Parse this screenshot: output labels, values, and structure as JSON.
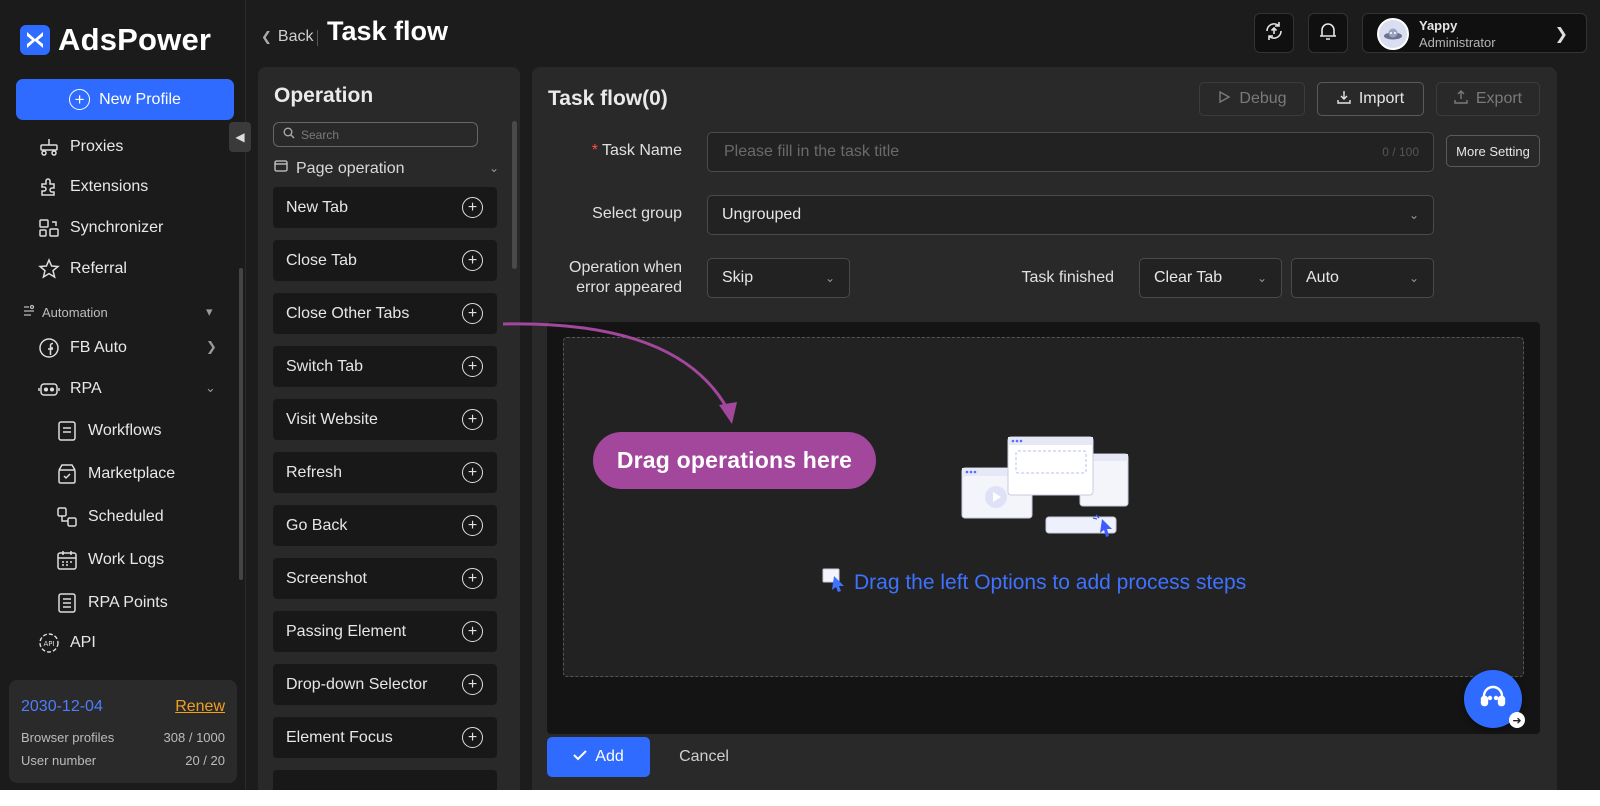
{
  "app": {
    "name": "AdsPower"
  },
  "sidebar": {
    "new_profile_label": "New Profile",
    "items": [
      {
        "label": "Proxies",
        "icon": "proxies-icon"
      },
      {
        "label": "Extensions",
        "icon": "extensions-icon"
      },
      {
        "label": "Synchronizer",
        "icon": "synchronizer-icon"
      },
      {
        "label": "Referral",
        "icon": "star-icon"
      }
    ],
    "automation_section": "Automation",
    "fb_auto_label": "FB Auto",
    "rpa_label": "RPA",
    "rpa_sub": [
      {
        "label": "Workflows",
        "icon": "workflows-icon"
      },
      {
        "label": "Marketplace",
        "icon": "marketplace-icon"
      },
      {
        "label": "Scheduled",
        "icon": "scheduled-icon"
      },
      {
        "label": "Work Logs",
        "icon": "calendar-icon"
      },
      {
        "label": "RPA Points",
        "icon": "points-icon"
      }
    ],
    "api_label": "API",
    "account": {
      "date": "2030-12-04",
      "renew": "Renew",
      "browser_profiles_label": "Browser profiles",
      "browser_profiles_value": "308 / 1000",
      "user_number_label": "User number",
      "user_number_value": "20 / 20"
    }
  },
  "header": {
    "back_label": "Back",
    "title": "Task flow",
    "user": {
      "name": "Yappy",
      "role": "Administrator"
    }
  },
  "operation": {
    "title": "Operation",
    "search_placeholder": "Search",
    "category": "Page operation",
    "items": [
      "New Tab",
      "Close Tab",
      "Close Other Tabs",
      "Switch Tab",
      "Visit Website",
      "Refresh",
      "Go Back",
      "Screenshot",
      "Passing Element",
      "Drop-down Selector",
      "Element Focus"
    ]
  },
  "taskflow": {
    "title": "Task flow(0)",
    "debug_label": "Debug",
    "import_label": "Import",
    "export_label": "Export",
    "task_name_label": "Task Name",
    "task_name_placeholder": "Please fill in the task title",
    "task_name_count": "0 / 100",
    "more_setting_label": "More Setting",
    "select_group_label": "Select group",
    "select_group_value": "Ungrouped",
    "error_label_line1": "Operation when",
    "error_label_line2": "error appeared",
    "error_value": "Skip",
    "finished_label": "Task finished",
    "finished_value": "Clear Tab",
    "finished_mode": "Auto",
    "drop_hint": "Drag the left Options to add process steps",
    "callout": "Drag operations here",
    "add_label": "Add",
    "cancel_label": "Cancel"
  },
  "colors": {
    "accent": "#2f6bff",
    "callout": "#a2479c",
    "renew": "#f0a020",
    "hint": "#3e72ff"
  }
}
